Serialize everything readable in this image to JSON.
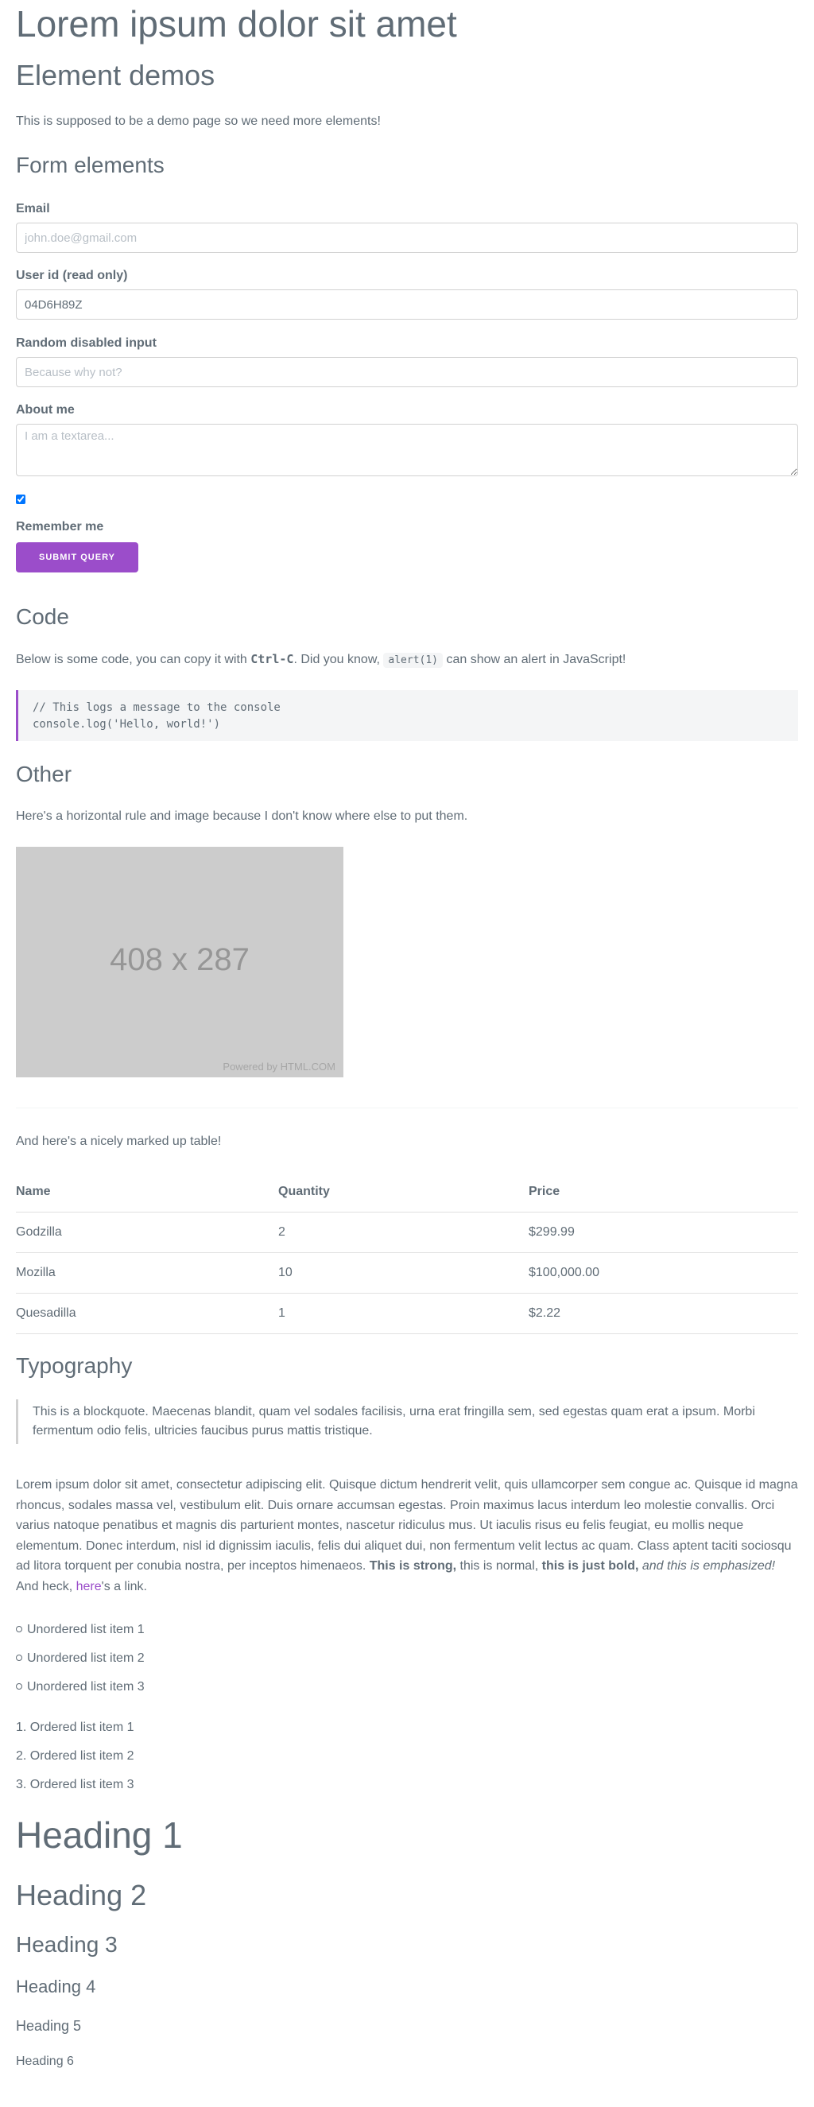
{
  "page": {
    "title": "Lorem ipsum dolor sit amet",
    "section_title": "Element demos",
    "intro": "This is supposed to be a demo page so we need more elements!"
  },
  "form": {
    "title": "Form elements",
    "email": {
      "label": "Email",
      "placeholder": "john.doe@gmail.com"
    },
    "userid": {
      "label": "User id (read only)",
      "value": "04D6H89Z"
    },
    "disabled": {
      "label": "Random disabled input",
      "placeholder": "Because why not?"
    },
    "about": {
      "label": "About me",
      "placeholder": "I am a textarea..."
    },
    "remember": {
      "label": "Remember me",
      "checked": true
    },
    "submit_label": "Submit Query"
  },
  "code": {
    "title": "Code",
    "desc_pre": "Below is some code, you can copy it with ",
    "kbd": "Ctrl-C",
    "desc_mid": ". Did you know, ",
    "inline": "alert(1)",
    "desc_post": " can show an alert in JavaScript!",
    "block": "// This logs a message to the console\nconsole.log('Hello, world!')"
  },
  "other": {
    "title": "Other",
    "desc": "Here's a horizontal rule and image because I don't know where else to put them.",
    "image_text": "408 x 287",
    "image_credit": "Powered by HTML.COM",
    "table_intro": "And here's a nicely marked up table!",
    "table": {
      "headers": [
        "Name",
        "Quantity",
        "Price"
      ],
      "rows": [
        [
          "Godzilla",
          "2",
          "$299.99"
        ],
        [
          "Mozilla",
          "10",
          "$100,000.00"
        ],
        [
          "Quesadilla",
          "1",
          "$2.22"
        ]
      ]
    }
  },
  "typography": {
    "title": "Typography",
    "blockquote": "This is a blockquote. Maecenas blandit, quam vel sodales facilisis, urna erat fringilla sem, sed egestas quam erat a ipsum. Morbi fermentum odio felis, ultricies faucibus purus mattis tristique.",
    "paragraph": "Lorem ipsum dolor sit amet, consectetur adipiscing elit. Quisque dictum hendrerit velit, quis ullamcorper sem congue ac. Quisque id magna rhoncus, sodales massa vel, vestibulum elit. Duis ornare accumsan egestas. Proin maximus lacus interdum leo molestie convallis. Orci varius natoque penatibus et magnis dis parturient montes, nascetur ridiculus mus. Ut iaculis risus eu felis feugiat, eu mollis neque elementum. Donec interdum, nisl id dignissim iaculis, felis dui aliquet dui, non fermentum velit lectus ac quam. Class aptent taciti sociosqu ad litora torquent per conubia nostra, per inceptos himenaeos. ",
    "strong": "This is strong,",
    "normal": " this is normal, ",
    "bold": "this is just bold,",
    "em": " and this is emphasized!",
    "heck": " And heck, ",
    "link": "here",
    "link_tail": "'s a link.",
    "unordered": [
      "Unordered list item 1",
      "Unordered list item 2",
      "Unordered list item 3"
    ],
    "ordered": [
      "1. Ordered list item 1",
      "2. Ordered list item 2",
      "3. Ordered list item 3"
    ],
    "headings": [
      "Heading 1",
      "Heading 2",
      "Heading 3",
      "Heading 4",
      "Heading 5",
      "Heading 6"
    ]
  }
}
